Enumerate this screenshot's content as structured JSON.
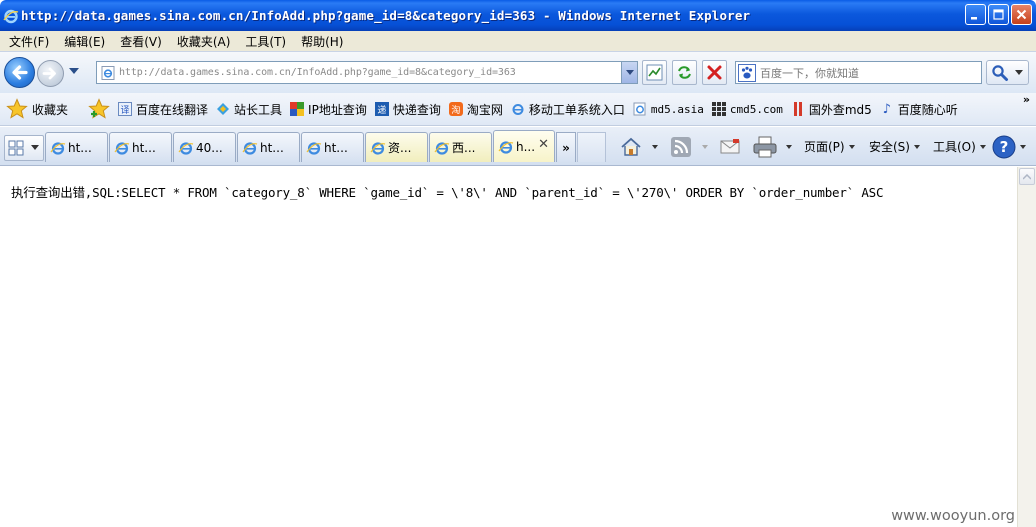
{
  "window": {
    "title": "http://data.games.sina.com.cn/InfoAdd.php?game_id=8&category_id=363 - Windows Internet Explorer"
  },
  "menu": {
    "items": [
      "文件(F)",
      "编辑(E)",
      "查看(V)",
      "收藏夹(A)",
      "工具(T)",
      "帮助(H)"
    ]
  },
  "address_bar": {
    "url": "http://data.games.sina.com.cn/InfoAdd.php?game_id=8&category_id=363"
  },
  "search": {
    "placeholder": "百度一下，你就知道"
  },
  "favorites": {
    "label": "收藏夹",
    "items": [
      "百度在线翻译",
      "站长工具",
      "IP地址查询",
      "快递查询",
      "淘宝网",
      "移动工单系统入口",
      "md5.asia",
      "cmd5.com",
      "国外查md5",
      "百度随心听"
    ]
  },
  "tabs": [
    {
      "label": "ht..."
    },
    {
      "label": "ht..."
    },
    {
      "label": "40..."
    },
    {
      "label": "ht..."
    },
    {
      "label": "ht..."
    },
    {
      "label": "资..."
    },
    {
      "label": "西..."
    },
    {
      "label": "h..."
    }
  ],
  "tab_overflow": "»",
  "commands": {
    "page": "页面(P)",
    "safety": "安全(S)",
    "tools": "工具(O)"
  },
  "content": {
    "error_message": "执行查询出错,SQL:SELECT * FROM `category_8` WHERE `game_id` = \\'8\\' AND `parent_id` = \\'270\\' ORDER BY `order_number` ASC"
  },
  "watermark": "www.wooyun.org",
  "colors": {
    "titlebar": "#0650d6",
    "menubar": "#ece9d8",
    "active_tab": "#f7f3c9"
  }
}
